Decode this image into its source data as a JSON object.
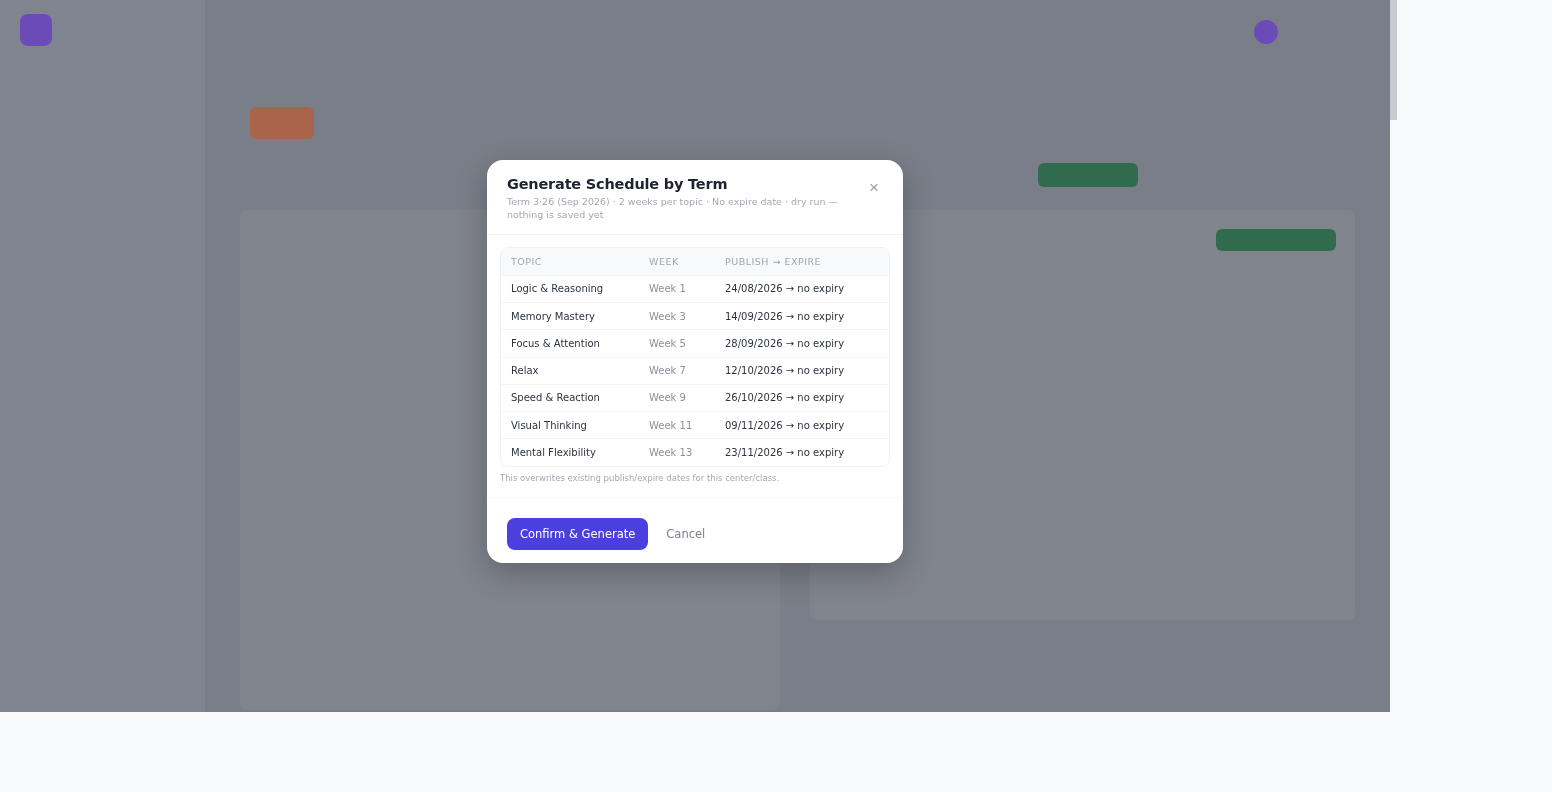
{
  "dialog": {
    "title": "Generate Schedule by Term",
    "subtitle": "Term 3·26 (Sep 2026) · 2 weeks per topic · No expire date · dry run — nothing is saved yet",
    "close": "×",
    "table": {
      "columns": [
        "TOPIC",
        "WEEK",
        "PUBLISH → EXPIRE"
      ],
      "rows": [
        [
          "Logic & Reasoning",
          "Week 1",
          "24/08/2026 → no expiry"
        ],
        [
          "Memory Mastery",
          "Week 3",
          "14/09/2026 → no expiry"
        ],
        [
          "Focus & Attention",
          "Week 5",
          "28/09/2026 → no expiry"
        ],
        [
          "Relax",
          "Week 7",
          "12/10/2026 → no expiry"
        ],
        [
          "Speed & Reaction",
          "Week 9",
          "26/10/2026 → no expiry"
        ],
        [
          "Visual Thinking",
          "Week 11",
          "09/11/2026 → no expiry"
        ],
        [
          "Mental Flexibility",
          "Week 13",
          "23/11/2026 → no expiry"
        ]
      ]
    },
    "note": "This overwrites existing publish/expire dates for this center/class.",
    "buttons": [
      {
        "label": "Confirm & Generate",
        "kind": "primary"
      },
      {
        "label": "Cancel",
        "kind": "link"
      }
    ]
  }
}
